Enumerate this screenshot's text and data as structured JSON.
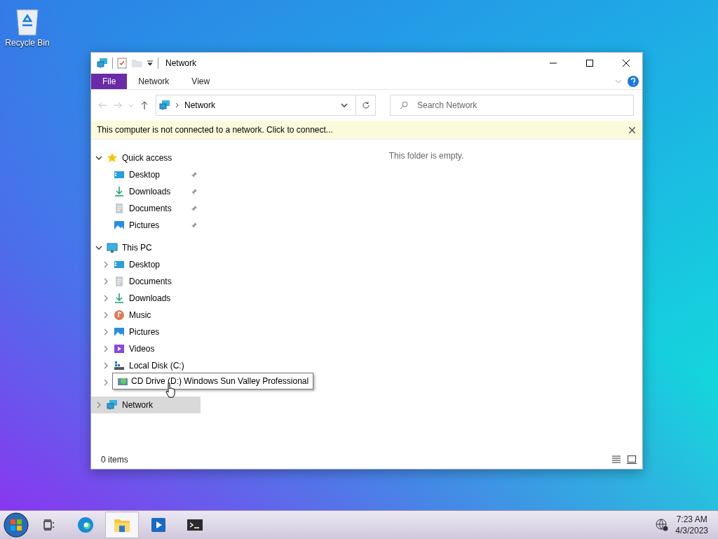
{
  "desktop": {
    "icons": [
      {
        "label": "Recycle Bin",
        "kind": "recycle"
      }
    ]
  },
  "window": {
    "title": "Network",
    "ribbon_tabs": [
      {
        "label": "File",
        "selected": true
      },
      {
        "label": "Network",
        "selected": false
      },
      {
        "label": "View",
        "selected": false
      }
    ],
    "address": {
      "path": "Network"
    },
    "search": {
      "placeholder": "Search Network"
    },
    "info_bar": {
      "message": "This computer is not connected to a network. Click to connect..."
    },
    "nav": [
      {
        "label": "Quick access",
        "kind": "star",
        "expanded": true,
        "selected": false,
        "children": [
          {
            "label": "Desktop",
            "kind": "desktop",
            "pinned": true,
            "selected": false
          },
          {
            "label": "Downloads",
            "kind": "download",
            "pinned": true,
            "selected": false
          },
          {
            "label": "Documents",
            "kind": "document",
            "pinned": true,
            "selected": false
          },
          {
            "label": "Pictures",
            "kind": "picture",
            "pinned": true,
            "selected": false
          }
        ]
      },
      {
        "label": "This PC",
        "kind": "pc",
        "expanded": true,
        "selected": false,
        "children": [
          {
            "label": "Desktop",
            "kind": "desktop",
            "expanded": false,
            "selected": false
          },
          {
            "label": "Documents",
            "kind": "document",
            "expanded": false,
            "selected": false
          },
          {
            "label": "Downloads",
            "kind": "download",
            "expanded": false,
            "selected": false
          },
          {
            "label": "Music",
            "kind": "music",
            "expanded": false,
            "selected": false
          },
          {
            "label": "Pictures",
            "kind": "picture",
            "expanded": false,
            "selected": false
          },
          {
            "label": "Videos",
            "kind": "video",
            "expanded": false,
            "selected": false
          },
          {
            "label": "Local Disk (C:)",
            "kind": "disk",
            "expanded": false,
            "selected": false
          },
          {
            "tooltip": "CD Drive (D:) Windows Sun Valley Professional",
            "kind": "cd",
            "expanded": false,
            "selected": false
          }
        ]
      },
      {
        "label": "Network",
        "kind": "network",
        "expanded": false,
        "selected": true
      }
    ],
    "empty_message": "This folder is empty.",
    "status": "0 items"
  },
  "taskbar": {
    "apps": [
      {
        "kind": "taskview",
        "active": false
      },
      {
        "kind": "edge",
        "active": false
      },
      {
        "kind": "explorer",
        "active": true
      },
      {
        "kind": "media",
        "active": false
      },
      {
        "kind": "terminal",
        "active": false
      }
    ],
    "time": "7:23 AM",
    "date": "4/3/2023"
  }
}
